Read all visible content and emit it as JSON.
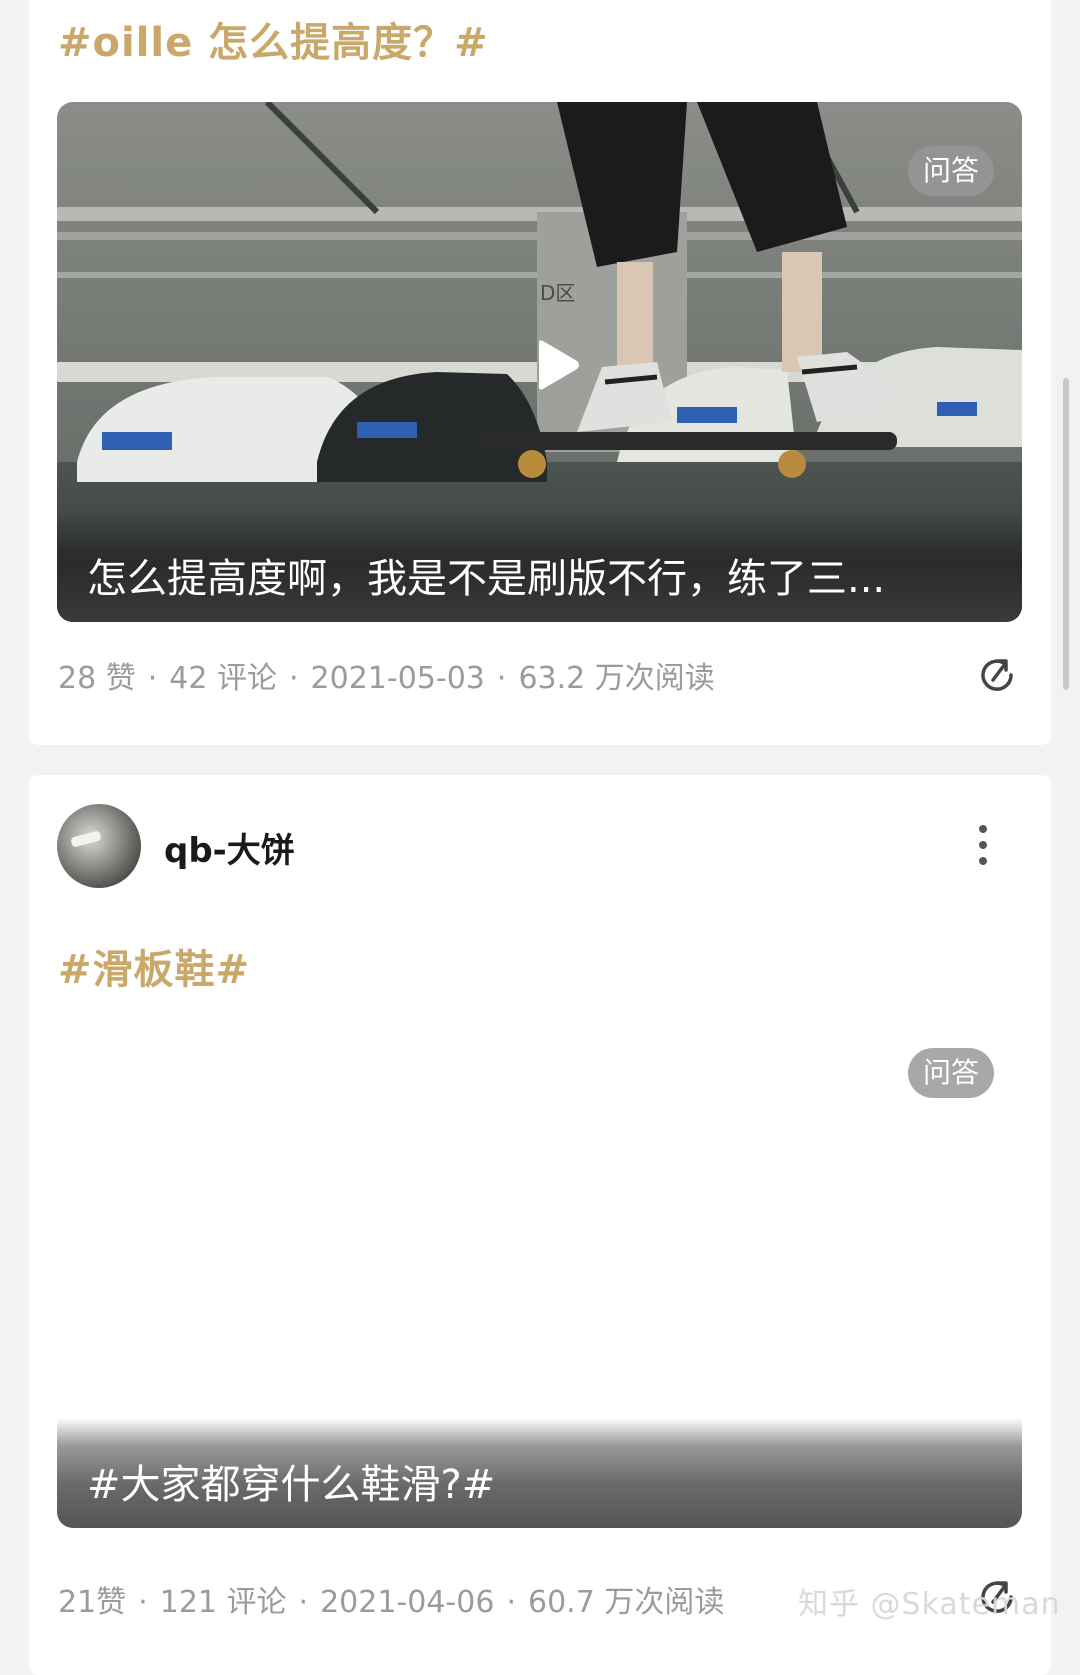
{
  "posts": [
    {
      "topic_tag": "#oille 怎么提高度？#",
      "badge": "问答",
      "caption": "怎么提高度啊，我是不是刷版不行，练了三...",
      "stats": {
        "likes": "28 赞",
        "comments": "42 评论",
        "date": "2021-05-03",
        "views": "63.2 万次阅读"
      }
    },
    {
      "author": "qb-大饼",
      "topic_tag": "#滑板鞋#",
      "badge": "问答",
      "caption": "#大家都穿什么鞋滑?#",
      "stats": {
        "likes": "21赞",
        "comments": "121 评论",
        "date": "2021-04-06",
        "views": "60.7 万次阅读"
      }
    }
  ],
  "watermark": "知乎 @Skateman",
  "colors": {
    "topic": "#c9a86a",
    "meta": "#9b9b9b",
    "badge": "#969696",
    "background": "#f2f2f5"
  },
  "icons": [
    "play-icon",
    "share-icon",
    "more-vertical-icon",
    "avatar-image"
  ]
}
